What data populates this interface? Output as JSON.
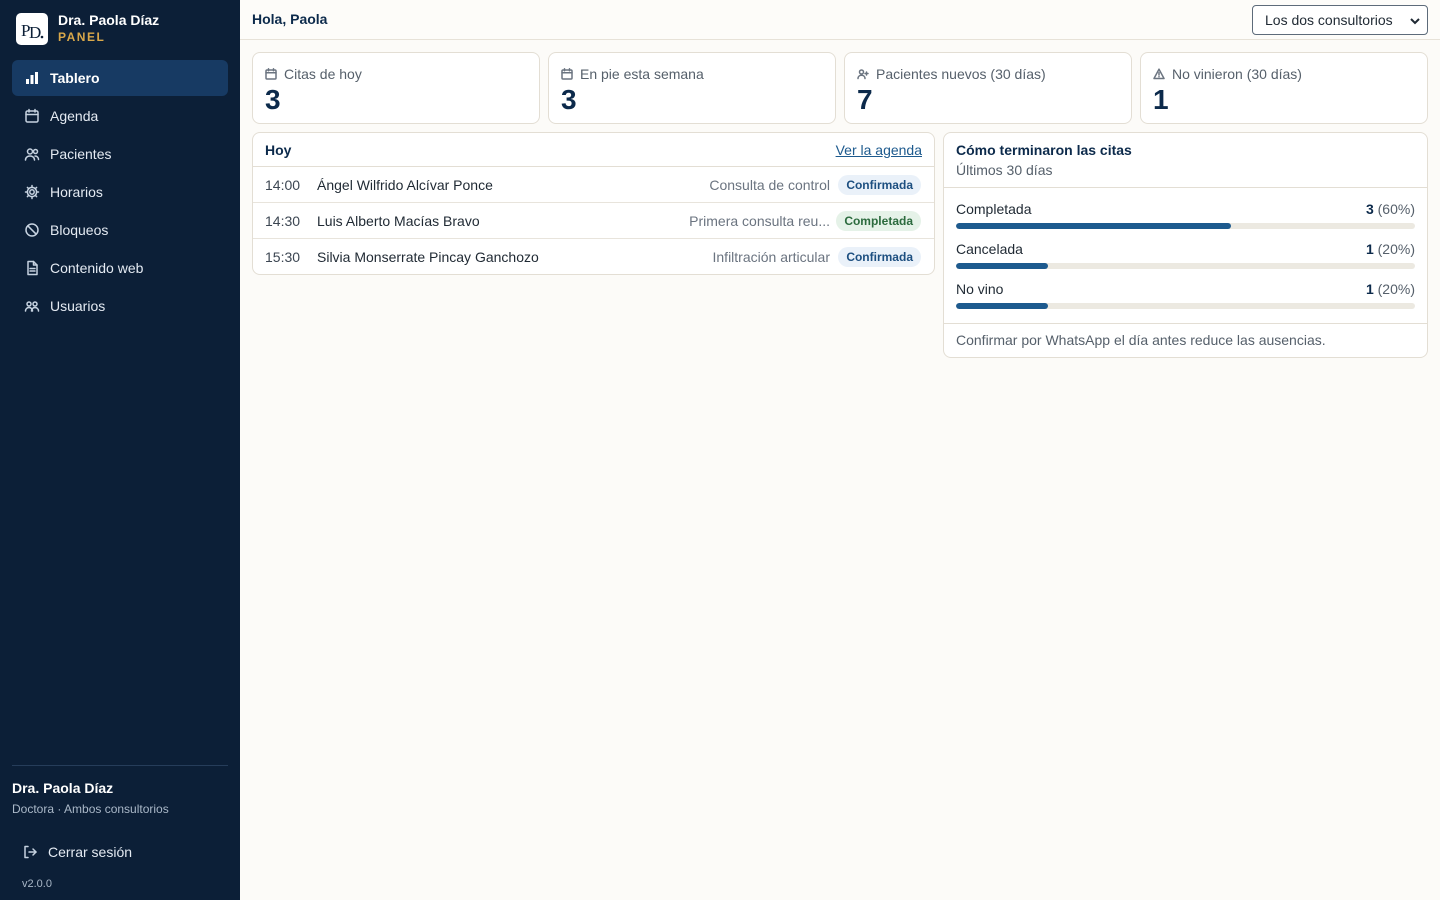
{
  "sidebar": {
    "brand_name": "Dra. Paola Díaz",
    "brand_sub": "PANEL",
    "items": [
      {
        "label": "Tablero",
        "icon": "bar-chart-icon"
      },
      {
        "label": "Agenda",
        "icon": "calendar-icon"
      },
      {
        "label": "Pacientes",
        "icon": "users-icon"
      },
      {
        "label": "Horarios",
        "icon": "gear-icon"
      },
      {
        "label": "Bloqueos",
        "icon": "ban-icon"
      },
      {
        "label": "Contenido web",
        "icon": "document-icon"
      },
      {
        "label": "Usuarios",
        "icon": "user-group-icon"
      }
    ],
    "user_name": "Dra. Paola Díaz",
    "user_role": "Doctora · Ambos consultorios",
    "logout_label": "Cerrar sesión",
    "version": "v2.0.0"
  },
  "header": {
    "greeting": "Hola, Paola",
    "office_select": "Los dos consultorios"
  },
  "stats": [
    {
      "label": "Citas de hoy",
      "value": "3",
      "icon": "calendar-icon"
    },
    {
      "label": "En pie esta semana",
      "value": "3",
      "icon": "calendar-icon"
    },
    {
      "label": "Pacientes nuevos (30 días)",
      "value": "7",
      "icon": "user-plus-icon"
    },
    {
      "label": "No vinieron (30 días)",
      "value": "1",
      "icon": "warning-icon"
    }
  ],
  "today": {
    "title": "Hoy",
    "link": "Ver la agenda",
    "appointments": [
      {
        "time": "14:00",
        "name": "Ángel Wilfrido Alcívar Ponce",
        "type": "Consulta de control",
        "status": "Confirmada"
      },
      {
        "time": "14:30",
        "name": "Luis Alberto Macías Bravo",
        "type": "Primera consulta reu...",
        "status": "Completada"
      },
      {
        "time": "15:30",
        "name": "Silvia Monserrate Pincay Ganchozo",
        "type": "Infiltración articular",
        "status": "Confirmada"
      }
    ]
  },
  "outcomes": {
    "title": "Cómo terminaron las citas",
    "subtitle": "Últimos 30 días",
    "rows": [
      {
        "label": "Completada",
        "count": "3",
        "pct": "(60%)",
        "fraction": 0.6
      },
      {
        "label": "Cancelada",
        "count": "1",
        "pct": "(20%)",
        "fraction": 0.2
      },
      {
        "label": "No vino",
        "count": "1",
        "pct": "(20%)",
        "fraction": 0.2
      }
    ],
    "note": "Confirmar por WhatsApp el día antes reduce las ausencias."
  },
  "colors": {
    "sidebar": "#0c1f37",
    "accent": "#1d5a8e",
    "brand_gold": "#d9a84a"
  }
}
